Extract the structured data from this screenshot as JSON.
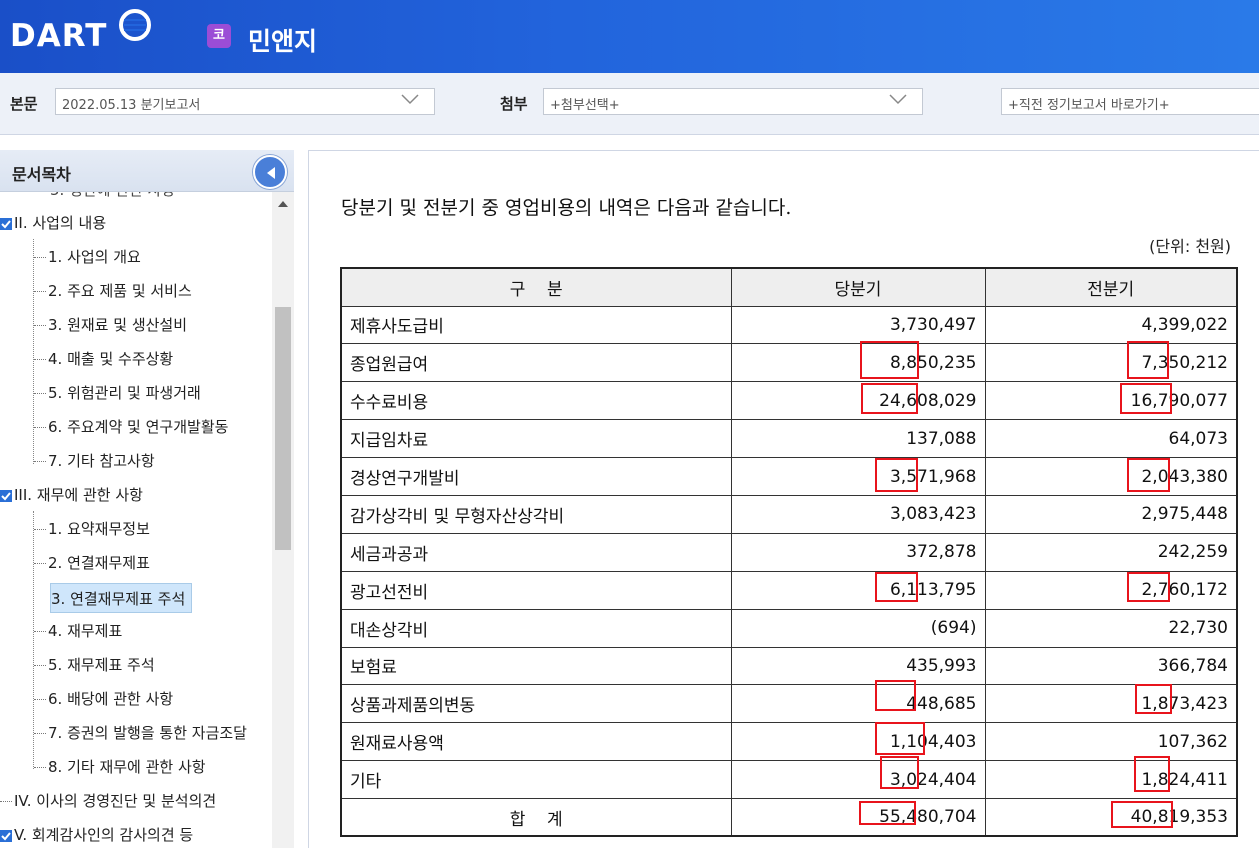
{
  "header": {
    "logo": "DART",
    "corp_badge": "코",
    "corp_name": "민앤지"
  },
  "selectbar": {
    "body_label": "본문",
    "body_value": "2022.05.13  분기보고서",
    "attach_label": "첨부",
    "attach_value": "+첨부선택+",
    "prev_value": "+직전 정기보고서 바로가기+"
  },
  "sidebar": {
    "title": "문서목차",
    "partial_top": "5. 정관에 관한 사항",
    "items": [
      {
        "label": "II. 사업의 내용"
      },
      {
        "label": "1. 사업의 개요"
      },
      {
        "label": "2. 주요 제품 및 서비스"
      },
      {
        "label": "3. 원재료 및 생산설비"
      },
      {
        "label": "4. 매출 및 수주상황"
      },
      {
        "label": "5. 위험관리 및 파생거래"
      },
      {
        "label": "6. 주요계약 및 연구개발활동"
      },
      {
        "label": "7. 기타 참고사항"
      },
      {
        "label": "III. 재무에 관한 사항"
      },
      {
        "label": "1. 요약재무정보"
      },
      {
        "label": "2. 연결재무제표"
      },
      {
        "label": "3. 연결재무제표 주석"
      },
      {
        "label": "4. 재무제표"
      },
      {
        "label": "5. 재무제표 주석"
      },
      {
        "label": "6. 배당에 관한 사항"
      },
      {
        "label": "7. 증권의 발행을 통한 자금조달"
      },
      {
        "label": "8. 기타 재무에 관한 사항"
      },
      {
        "label": "IV. 이사의 경영진단 및 분석의견"
      },
      {
        "label": "V. 회계감사인의 감사의견 등"
      }
    ]
  },
  "content": {
    "intro": "당분기 및 전분기 중 영업비용의 내역은 다음과 같습니다.",
    "unit": "(단위: 천원)",
    "columns": [
      "구    분",
      "당분기",
      "전분기"
    ],
    "rows": [
      {
        "label": "제휴사도급비",
        "current": "3,730,497",
        "prior": "4,399,022"
      },
      {
        "label": "종업원급여",
        "current": "8,850,235",
        "prior": "7,350,212"
      },
      {
        "label": "수수료비용",
        "current": "24,608,029",
        "prior": "16,790,077"
      },
      {
        "label": "지급임차료",
        "current": "137,088",
        "prior": "64,073"
      },
      {
        "label": "경상연구개발비",
        "current": "3,571,968",
        "prior": "2,043,380"
      },
      {
        "label": "감가상각비 및 무형자산상각비",
        "current": "3,083,423",
        "prior": "2,975,448"
      },
      {
        "label": "세금과공과",
        "current": "372,878",
        "prior": "242,259"
      },
      {
        "label": "광고선전비",
        "current": "6,113,795",
        "prior": "2,760,172"
      },
      {
        "label": "대손상각비",
        "current": "(694)",
        "prior": "22,730"
      },
      {
        "label": "보험료",
        "current": "435,993",
        "prior": "366,784"
      },
      {
        "label": "상품과제품의변동",
        "current": "448,685",
        "prior": "1,873,423"
      },
      {
        "label": "원재료사용액",
        "current": "1,104,403",
        "prior": "107,362"
      },
      {
        "label": "기타",
        "current": "3,024,404",
        "prior": "1,824,411"
      }
    ],
    "total": {
      "label": "합    계",
      "current": "55,480,704",
      "prior": "40,819,353"
    }
  },
  "colors": {
    "header_blue": "#2264dc",
    "highlight_red": "#e8141c",
    "selected_node": "#cfe6fb"
  }
}
